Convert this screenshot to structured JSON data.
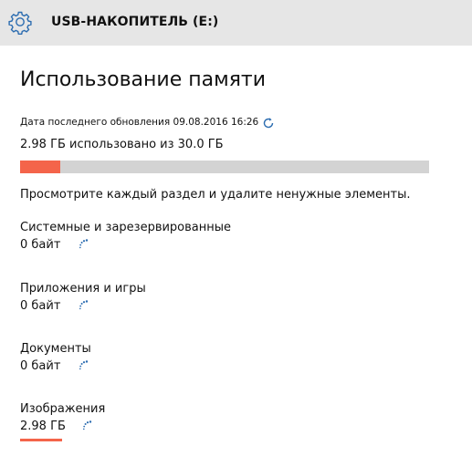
{
  "header": {
    "title": "USB-НАКОПИТЕЛЬ (E:)",
    "icon": "gear-icon"
  },
  "main": {
    "title": "Использование памяти",
    "updated": "Дата последнего обновления 09.08.2016 16:26",
    "refresh_icon": "refresh-icon",
    "used_text": "2.98 ГБ использовано из 30.0 ГБ",
    "used_fraction": 0.0993,
    "accent_color": "#f4644a",
    "bar_bg_color": "#d3d3d3",
    "hint": "Просмотрите каждый раздел и удалите ненужные элементы."
  },
  "categories": [
    {
      "name": "Системные и зарезервированные",
      "size": "0 байт"
    },
    {
      "name": "Приложения и игры",
      "size": "0 байт"
    },
    {
      "name": "Документы",
      "size": "0 байт"
    },
    {
      "name": "Изображения",
      "size": "2.98 ГБ"
    }
  ]
}
